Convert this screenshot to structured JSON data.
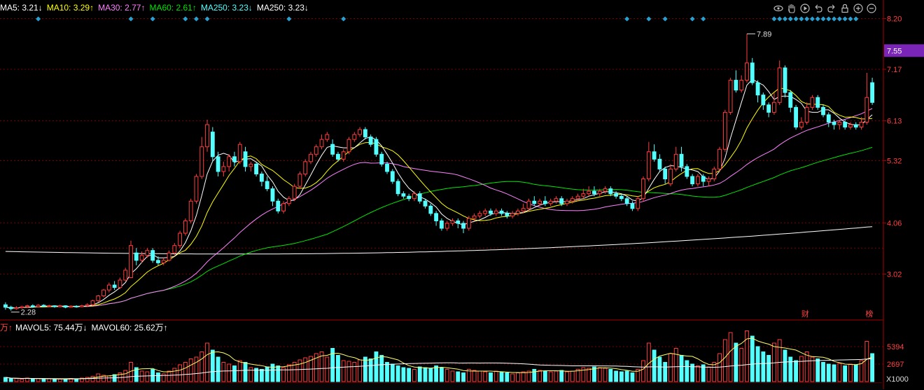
{
  "legend": {
    "ma5": "MA5: 3.21↓",
    "ma10": "MA10: 3.29↑",
    "ma30": "MA30: 2.77↑",
    "ma60": "MA60: 2.61↑",
    "ma250a": "MA250: 3.23↓",
    "ma250b": "MA250: 3.23↓"
  },
  "vol_legend": {
    "prefix": "万↑",
    "mavol5": "MAVOL5: 75.44万↓",
    "mavol60": "MAVOL60: 25.62万↑"
  },
  "colors": {
    "up": "#ff3c3c",
    "down": "#54ffff",
    "ma5": "#ffffff",
    "ma10": "#ffff00",
    "ma30": "#ff80ff",
    "ma60": "#00e600",
    "ma250": "#ffffff",
    "grid": "#7a0000",
    "axis_text": "#ff4040",
    "highlight_box": "#7b25b8",
    "marker": "#2aa0d0"
  },
  "toolbar_icons": [
    "eye-icon",
    "hand-icon",
    "play-icon",
    "undo-icon",
    "redo-icon",
    "lock-icon",
    "zoom-in-icon",
    "zoom-out-icon"
  ],
  "chart_data": {
    "type": "candlestick",
    "price_axis": {
      "ticks": [
        "8.20",
        "7.17",
        "6.13",
        "5.32",
        "4.06",
        "3.02"
      ],
      "highlight": "7.55",
      "max_label": "7.89",
      "min_label": "2.28"
    },
    "volume_axis": {
      "ticks": [
        "5394",
        "2697"
      ],
      "unit": "X1000"
    },
    "markers": {
      "finance": "财",
      "list": "榜"
    },
    "candles": [
      [
        2.4,
        2.35,
        2.45,
        2.3
      ],
      [
        2.35,
        2.32,
        2.38,
        2.28
      ],
      [
        2.32,
        2.34,
        2.37,
        2.3
      ],
      [
        2.34,
        2.36,
        2.38,
        2.32
      ],
      [
        2.36,
        2.38,
        2.4,
        2.34
      ],
      [
        2.38,
        2.36,
        2.41,
        2.34
      ],
      [
        2.36,
        2.39,
        2.41,
        2.35
      ],
      [
        2.39,
        2.37,
        2.41,
        2.35
      ],
      [
        2.37,
        2.38,
        2.4,
        2.35
      ],
      [
        2.38,
        2.36,
        2.39,
        2.34
      ],
      [
        2.36,
        2.38,
        2.4,
        2.35
      ],
      [
        2.38,
        2.35,
        2.39,
        2.33
      ],
      [
        2.35,
        2.37,
        2.39,
        2.34
      ],
      [
        2.37,
        2.36,
        2.39,
        2.34
      ],
      [
        2.36,
        2.38,
        2.4,
        2.35
      ],
      [
        2.38,
        2.4,
        2.43,
        2.36
      ],
      [
        2.4,
        2.48,
        2.5,
        2.38
      ],
      [
        2.48,
        2.58,
        2.6,
        2.45
      ],
      [
        2.58,
        2.7,
        2.72,
        2.55
      ],
      [
        2.7,
        2.8,
        2.85,
        2.65
      ],
      [
        2.8,
        2.75,
        2.88,
        2.7
      ],
      [
        2.75,
        2.9,
        2.95,
        2.72
      ],
      [
        2.9,
        3.1,
        3.15,
        2.88
      ],
      [
        2.95,
        3.6,
        3.7,
        2.95
      ],
      [
        3.45,
        3.3,
        3.55,
        3.2
      ],
      [
        3.3,
        3.4,
        3.48,
        3.25
      ],
      [
        3.4,
        3.5,
        3.55,
        3.35
      ],
      [
        3.5,
        3.3,
        3.55,
        3.25
      ],
      [
        3.3,
        3.25,
        3.38,
        3.2
      ],
      [
        3.25,
        3.3,
        3.35,
        3.2
      ],
      [
        3.3,
        3.45,
        3.5,
        3.28
      ],
      [
        3.45,
        3.6,
        3.65,
        3.4
      ],
      [
        3.6,
        3.85,
        3.9,
        3.55
      ],
      [
        3.85,
        4.1,
        4.15,
        3.8
      ],
      [
        4.1,
        4.5,
        4.55,
        4.05
      ],
      [
        4.5,
        5.0,
        5.05,
        4.45
      ],
      [
        5.0,
        5.6,
        5.8,
        4.95
      ],
      [
        5.6,
        6.05,
        6.15,
        5.5
      ],
      [
        5.9,
        5.4,
        6.0,
        5.3
      ],
      [
        5.4,
        5.1,
        5.5,
        5.0
      ],
      [
        5.1,
        5.2,
        5.3,
        5.0
      ],
      [
        5.2,
        5.4,
        5.45,
        5.1
      ],
      [
        5.4,
        5.3,
        5.5,
        5.2
      ],
      [
        5.3,
        5.65,
        5.7,
        5.25
      ],
      [
        5.5,
        5.2,
        5.6,
        5.1
      ],
      [
        5.2,
        5.25,
        5.3,
        5.1
      ],
      [
        5.25,
        5.05,
        5.3,
        5.0
      ],
      [
        5.05,
        4.9,
        5.1,
        4.8
      ],
      [
        4.9,
        4.75,
        5.0,
        4.7
      ],
      [
        4.75,
        4.5,
        4.8,
        4.4
      ],
      [
        4.5,
        4.3,
        4.55,
        4.25
      ],
      [
        4.3,
        4.45,
        4.5,
        4.25
      ],
      [
        4.45,
        4.55,
        4.6,
        4.4
      ],
      [
        4.55,
        4.8,
        4.85,
        4.5
      ],
      [
        4.8,
        5.05,
        5.1,
        4.75
      ],
      [
        5.05,
        5.3,
        5.35,
        5.0
      ],
      [
        5.3,
        5.45,
        5.5,
        5.25
      ],
      [
        5.45,
        5.6,
        5.65,
        5.4
      ],
      [
        5.6,
        5.75,
        5.85,
        5.55
      ],
      [
        5.75,
        5.85,
        5.9,
        5.7
      ],
      [
        5.65,
        5.45,
        5.75,
        5.4
      ],
      [
        5.45,
        5.35,
        5.5,
        5.3
      ],
      [
        5.35,
        5.5,
        5.55,
        5.3
      ],
      [
        5.5,
        5.75,
        5.8,
        5.45
      ],
      [
        5.75,
        5.85,
        5.9,
        5.7
      ],
      [
        5.85,
        5.95,
        6.0,
        5.8
      ],
      [
        5.95,
        5.8,
        6.0,
        5.75
      ],
      [
        5.8,
        5.65,
        5.85,
        5.6
      ],
      [
        5.75,
        5.45,
        5.8,
        5.4
      ],
      [
        5.45,
        5.25,
        5.5,
        5.2
      ],
      [
        5.25,
        5.1,
        5.3,
        5.05
      ],
      [
        5.1,
        4.9,
        5.15,
        4.85
      ],
      [
        4.9,
        4.65,
        4.95,
        4.6
      ],
      [
        4.65,
        4.6,
        4.7,
        4.55
      ],
      [
        4.6,
        4.55,
        4.65,
        4.5
      ],
      [
        4.55,
        4.65,
        4.7,
        4.5
      ],
      [
        4.65,
        4.5,
        4.7,
        4.45
      ],
      [
        4.5,
        4.4,
        4.55,
        4.35
      ],
      [
        4.4,
        4.25,
        4.45,
        4.2
      ],
      [
        4.25,
        4.1,
        4.3,
        4.0
      ],
      [
        4.1,
        3.95,
        4.15,
        3.9
      ],
      [
        3.95,
        4.05,
        4.1,
        3.9
      ],
      [
        4.05,
        4.1,
        4.15,
        4.0
      ],
      [
        4.1,
        4.05,
        4.15,
        3.95
      ],
      [
        4.05,
        3.95,
        4.1,
        3.85
      ],
      [
        3.95,
        4.15,
        4.2,
        3.9
      ],
      [
        4.15,
        4.2,
        4.25,
        4.1
      ],
      [
        4.2,
        4.25,
        4.3,
        4.15
      ],
      [
        4.25,
        4.3,
        4.35,
        4.2
      ],
      [
        4.3,
        4.25,
        4.35,
        4.2
      ],
      [
        4.25,
        4.3,
        4.35,
        4.2
      ],
      [
        4.3,
        4.25,
        4.35,
        4.2
      ],
      [
        4.25,
        4.2,
        4.3,
        4.15
      ],
      [
        4.2,
        4.25,
        4.3,
        4.15
      ],
      [
        4.25,
        4.3,
        4.35,
        4.2
      ],
      [
        4.3,
        4.35,
        4.45,
        4.25
      ],
      [
        4.35,
        4.5,
        4.55,
        4.3
      ],
      [
        4.5,
        4.45,
        4.6,
        4.4
      ],
      [
        4.45,
        4.5,
        4.55,
        4.4
      ],
      [
        4.5,
        4.45,
        4.6,
        4.4
      ],
      [
        4.45,
        4.5,
        4.55,
        4.4
      ],
      [
        4.5,
        4.55,
        4.6,
        4.45
      ],
      [
        4.55,
        4.45,
        4.6,
        4.4
      ],
      [
        4.45,
        4.5,
        4.55,
        4.4
      ],
      [
        4.5,
        4.55,
        4.6,
        4.45
      ],
      [
        4.55,
        4.6,
        4.65,
        4.5
      ],
      [
        4.6,
        4.65,
        4.75,
        4.55
      ],
      [
        4.65,
        4.7,
        4.8,
        4.6
      ],
      [
        4.7,
        4.65,
        4.8,
        4.6
      ],
      [
        4.65,
        4.7,
        4.75,
        4.6
      ],
      [
        4.7,
        4.75,
        4.8,
        4.65
      ],
      [
        4.75,
        4.65,
        4.8,
        4.6
      ],
      [
        4.65,
        4.6,
        4.7,
        4.55
      ],
      [
        4.6,
        4.55,
        4.65,
        4.5
      ],
      [
        4.55,
        4.45,
        4.6,
        4.4
      ],
      [
        4.45,
        4.35,
        4.5,
        4.3
      ],
      [
        4.35,
        4.55,
        4.6,
        4.3
      ],
      [
        4.55,
        4.95,
        5.0,
        4.5
      ],
      [
        4.95,
        5.5,
        5.7,
        4.9
      ],
      [
        5.5,
        5.35,
        5.65,
        5.3
      ],
      [
        5.35,
        5.15,
        5.45,
        5.1
      ],
      [
        5.15,
        4.95,
        5.2,
        4.85
      ],
      [
        4.85,
        5.15,
        5.25,
        4.8
      ],
      [
        5.15,
        5.45,
        5.6,
        5.1
      ],
      [
        5.45,
        5.2,
        5.6,
        5.1
      ],
      [
        5.2,
        5.0,
        5.25,
        4.95
      ],
      [
        5.0,
        4.85,
        5.05,
        4.8
      ],
      [
        4.85,
        5.0,
        5.05,
        4.8
      ],
      [
        5.0,
        4.9,
        5.05,
        4.8
      ],
      [
        4.9,
        4.95,
        5.0,
        4.8
      ],
      [
        4.95,
        5.15,
        5.2,
        4.9
      ],
      [
        5.15,
        5.55,
        5.6,
        5.1
      ],
      [
        5.55,
        6.3,
        6.35,
        5.5
      ],
      [
        6.3,
        6.95,
        7.0,
        6.25
      ],
      [
        6.95,
        6.75,
        7.15,
        6.7
      ],
      [
        6.75,
        6.95,
        7.05,
        6.7
      ],
      [
        6.95,
        7.3,
        7.89,
        6.9
      ],
      [
        7.3,
        6.9,
        7.4,
        6.85
      ],
      [
        6.9,
        6.65,
        6.95,
        6.5
      ],
      [
        6.65,
        6.45,
        6.7,
        6.35
      ],
      [
        6.45,
        6.3,
        6.5,
        6.2
      ],
      [
        6.3,
        6.5,
        6.7,
        6.25
      ],
      [
        6.5,
        7.2,
        7.35,
        6.45
      ],
      [
        7.2,
        6.7,
        7.25,
        6.6
      ],
      [
        6.7,
        6.4,
        6.75,
        6.3
      ],
      [
        6.4,
        6.0,
        6.45,
        5.95
      ],
      [
        6.0,
        6.1,
        6.2,
        5.95
      ],
      [
        6.1,
        6.4,
        6.5,
        6.05
      ],
      [
        6.4,
        6.6,
        6.65,
        6.35
      ],
      [
        6.6,
        6.4,
        6.65,
        6.35
      ],
      [
        6.4,
        6.25,
        6.45,
        6.2
      ],
      [
        6.25,
        6.1,
        6.3,
        6.0
      ],
      [
        6.1,
        6.05,
        6.15,
        5.95
      ],
      [
        6.05,
        6.1,
        6.15,
        5.95
      ],
      [
        6.1,
        6.0,
        6.15,
        5.95
      ],
      [
        6.0,
        6.05,
        6.1,
        5.95
      ],
      [
        6.05,
        6.0,
        6.1,
        5.95
      ],
      [
        6.0,
        6.1,
        6.2,
        5.95
      ],
      [
        6.1,
        6.6,
        7.1,
        6.05
      ],
      [
        6.9,
        6.5,
        7.0,
        6.45
      ]
    ],
    "volumes": [
      12,
      8,
      9,
      7,
      10,
      8,
      9,
      7,
      8,
      6,
      7,
      8,
      9,
      7,
      10,
      12,
      15,
      22,
      18,
      16,
      20,
      25,
      32,
      55,
      40,
      30,
      28,
      35,
      25,
      22,
      30,
      38,
      48,
      55,
      65,
      70,
      85,
      110,
      90,
      70,
      55,
      50,
      45,
      60,
      55,
      40,
      38,
      35,
      42,
      50,
      45,
      40,
      48,
      55,
      62,
      68,
      72,
      80,
      85,
      70,
      95,
      75,
      60,
      58,
      55,
      62,
      70,
      65,
      85,
      75,
      55,
      50,
      45,
      40,
      38,
      35,
      42,
      40,
      38,
      45,
      40,
      35,
      30,
      28,
      25,
      35,
      32,
      30,
      28,
      25,
      30,
      28,
      25,
      22,
      25,
      28,
      30,
      35,
      32,
      30,
      28,
      30,
      32,
      28,
      30,
      35,
      40,
      38,
      42,
      40,
      38,
      35,
      30,
      28,
      30,
      25,
      35,
      60,
      110,
      90,
      70,
      55,
      80,
      95,
      75,
      60,
      50,
      45,
      48,
      42,
      55,
      80,
      120,
      140,
      110,
      95,
      145,
      130,
      100,
      85,
      75,
      110,
      120,
      90,
      70,
      60,
      72,
      85,
      70,
      65,
      55,
      50,
      48,
      52,
      45,
      50,
      48,
      60,
      115,
      80
    ]
  }
}
